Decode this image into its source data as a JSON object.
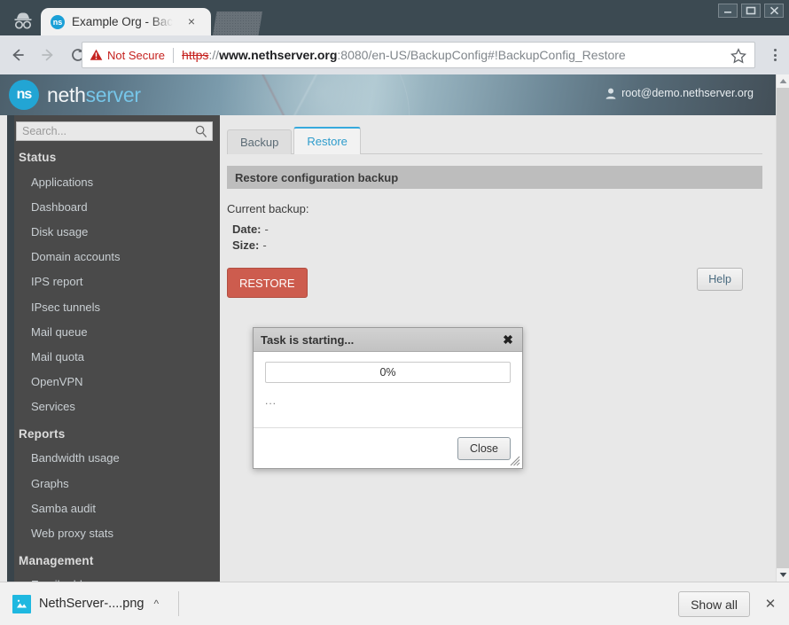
{
  "browser": {
    "incognito_icon": "incognito-hat-icon",
    "tab": {
      "favicon_label": "ns",
      "title": "Example Org - Bac",
      "close_label": "×"
    },
    "window_controls": {
      "minimize": "minimize-icon",
      "maximize": "maximize-icon",
      "close": "close-icon"
    },
    "nav": {
      "back_icon": "arrow-left-icon",
      "forward_icon": "arrow-right-icon",
      "reload_icon": "reload-icon",
      "star_icon": "star-icon",
      "menu_icon": "three-dots-vertical-icon"
    },
    "omnibox": {
      "security_label": "Not Secure",
      "security_icon": "warning-triangle-icon",
      "url_scheme": "https",
      "url_scheme_suffix": "://",
      "url_host": "www.nethserver.org",
      "url_path": ":8080/en-US/BackupConfig#!BackupConfig_Restore",
      "full_url": "https://www.nethserver.org:8080/en-US/BackupConfig#!BackupConfig_Restore"
    }
  },
  "app_header": {
    "logo_mark": "ns",
    "logo_word_primary": "neth",
    "logo_word_secondary": "server",
    "user_icon": "user-icon",
    "user": "root@demo.nethserver.org"
  },
  "sidebar": {
    "search": {
      "placeholder": "Search...",
      "value": "",
      "icon": "search-magnifier-icon"
    },
    "groups": [
      {
        "label": "Status",
        "items": [
          {
            "label": "Applications"
          },
          {
            "label": "Dashboard"
          },
          {
            "label": "Disk usage"
          },
          {
            "label": "Domain accounts"
          },
          {
            "label": "IPS report"
          },
          {
            "label": "IPsec tunnels"
          },
          {
            "label": "Mail queue"
          },
          {
            "label": "Mail quota"
          },
          {
            "label": "OpenVPN"
          },
          {
            "label": "Services"
          }
        ]
      },
      {
        "label": "Reports",
        "items": [
          {
            "label": "Bandwidth usage"
          },
          {
            "label": "Graphs"
          },
          {
            "label": "Samba audit"
          },
          {
            "label": "Web proxy stats"
          }
        ]
      },
      {
        "label": "Management",
        "items": [
          {
            "label": "Email addresses"
          }
        ]
      }
    ]
  },
  "main": {
    "tabs": [
      {
        "label": "Backup",
        "active": false
      },
      {
        "label": "Restore",
        "active": true
      }
    ],
    "panel_title": "Restore configuration backup",
    "current_backup_label": "Current backup:",
    "fields": [
      {
        "key": "Date:",
        "value": "-"
      },
      {
        "key": "Size:",
        "value": "-"
      }
    ],
    "restore_button": "RESTORE",
    "restore_button_visible_text": "RE",
    "help_button": "Help",
    "accent_color": "#37a9dd",
    "danger_color": "#cd5c4e"
  },
  "modal": {
    "title": "Task is starting...",
    "close_icon": "close-x-icon",
    "progress_percent_label": "0%",
    "progress_percent": 0,
    "status_text": "...",
    "close_button": "Close",
    "resize_grip_icon": "resize-grip-icon"
  },
  "download_shelf": {
    "file_icon": "image-file-icon",
    "file_name": "NethServer-....png",
    "caret_icon": "chevron-up-icon",
    "show_all_button": "Show all",
    "close_icon": "close-x-icon"
  }
}
